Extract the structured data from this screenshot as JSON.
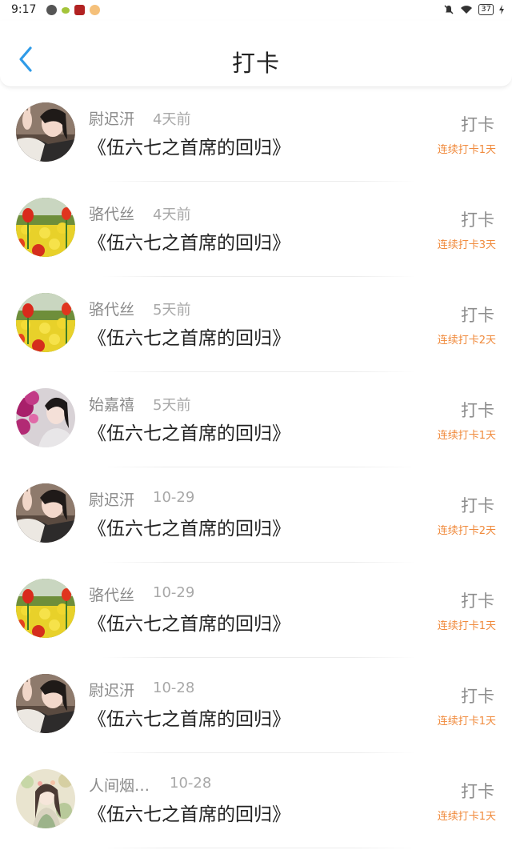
{
  "status_bar": {
    "time": "9:17",
    "battery": "37"
  },
  "header": {
    "title": "打卡"
  },
  "colors": {
    "accent_blue": "#2f9be8",
    "streak_orange": "#f08a3c",
    "muted_text": "#8a8a8a"
  },
  "checkins": [
    {
      "user": "尉迟汧",
      "time": "4天前",
      "book": "《伍六七之首席的回归》",
      "action": "打卡",
      "streak": "连续打卡1天",
      "avatar": "avatar-selfie"
    },
    {
      "user": "骆代丝",
      "time": "4天前",
      "book": "《伍六七之首席的回归》",
      "action": "打卡",
      "streak": "连续打卡3天",
      "avatar": "avatar-tulips"
    },
    {
      "user": "骆代丝",
      "time": "5天前",
      "book": "《伍六七之首席的回归》",
      "action": "打卡",
      "streak": "连续打卡2天",
      "avatar": "avatar-tulips"
    },
    {
      "user": "始嘉禧",
      "time": "5天前",
      "book": "《伍六七之首席的回归》",
      "action": "打卡",
      "streak": "连续打卡1天",
      "avatar": "avatar-flowers-woman"
    },
    {
      "user": "尉迟汧",
      "time": "10-29",
      "book": "《伍六七之首席的回归》",
      "action": "打卡",
      "streak": "连续打卡2天",
      "avatar": "avatar-selfie"
    },
    {
      "user": "骆代丝",
      "time": "10-29",
      "book": "《伍六七之首席的回归》",
      "action": "打卡",
      "streak": "连续打卡1天",
      "avatar": "avatar-tulips"
    },
    {
      "user": "尉迟汧",
      "time": "10-28",
      "book": "《伍六七之首席的回归》",
      "action": "打卡",
      "streak": "连续打卡1天",
      "avatar": "avatar-selfie"
    },
    {
      "user": "人间烟…",
      "time": "10-28",
      "book": "《伍六七之首席的回归》",
      "action": "打卡",
      "streak": "连续打卡1天",
      "avatar": "avatar-illustration"
    }
  ]
}
